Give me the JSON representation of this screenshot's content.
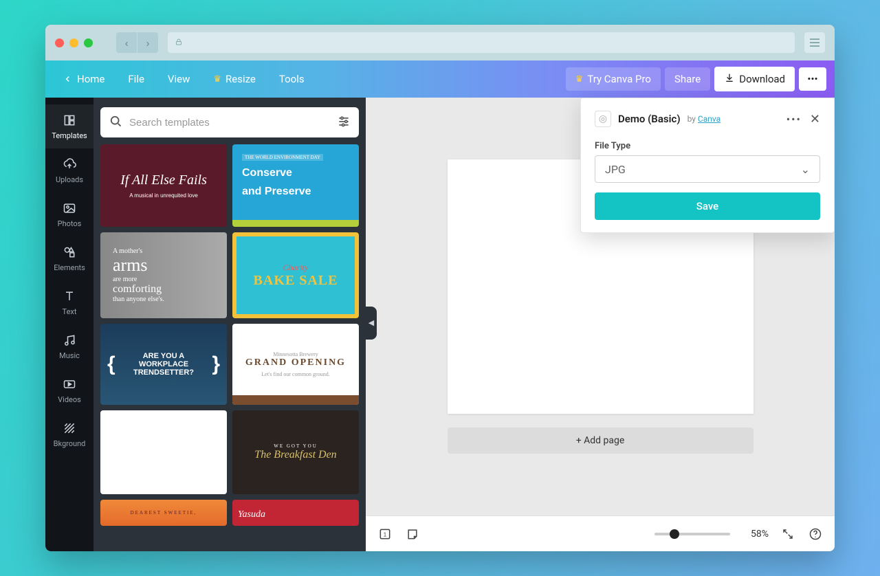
{
  "toolbar": {
    "home": "Home",
    "file": "File",
    "view": "View",
    "resize": "Resize",
    "tools": "Tools",
    "try_pro": "Try Canva Pro",
    "share": "Share",
    "download": "Download"
  },
  "rail": {
    "templates": "Templates",
    "uploads": "Uploads",
    "photos": "Photos",
    "elements": "Elements",
    "text": "Text",
    "music": "Music",
    "videos": "Videos",
    "background": "Bkground"
  },
  "search": {
    "placeholder": "Search templates"
  },
  "templates": {
    "t1": {
      "line1": "If All Else Fails",
      "line2": "A musical in unrequited love"
    },
    "t2": {
      "tag": "THE WORLD ENVIRONMENT DAY",
      "h1": "Conserve",
      "h2": "and Preserve"
    },
    "t3": {
      "lead": "A mother's",
      "big": "arms",
      "l2": "are more",
      "comf": "comforting",
      "l3": "than anyone else's."
    },
    "t4": {
      "charity": "Charity",
      "bake": "BAKE SALE"
    },
    "t5": {
      "q1": "ARE YOU A WORKPLACE",
      "q2": "TRENDSETTER?"
    },
    "t6": {
      "pre": "Minnesotta Brewery",
      "go": "GRAND OPENING",
      "tag": "Let's find our common ground."
    },
    "t8": {
      "pre": "WE GOT YOU",
      "title": "The Breakfast Den"
    },
    "t9": {
      "tag": "DEAREST SWEETIE,"
    },
    "t10": {
      "title": "Yasuda"
    }
  },
  "canvas": {
    "add_page_label": "+ Add page"
  },
  "status": {
    "page_count": "1",
    "zoom_label": "58%"
  },
  "popover": {
    "title": "Demo (Basic)",
    "by": "by",
    "source": "Canva",
    "file_type_label": "File Type",
    "file_type_value": "JPG",
    "save_label": "Save"
  }
}
